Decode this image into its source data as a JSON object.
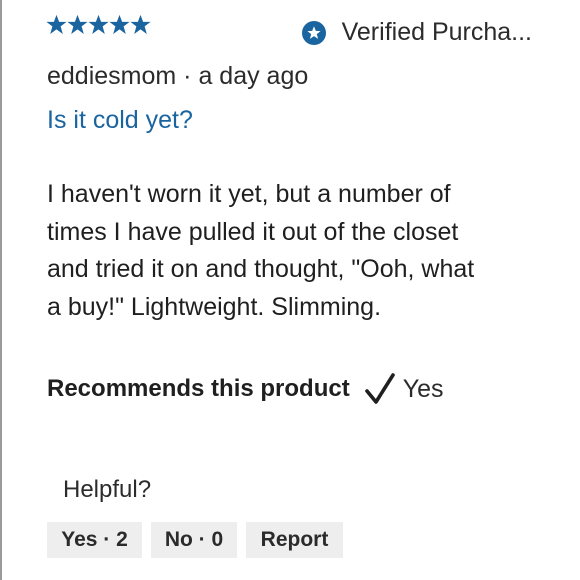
{
  "review": {
    "rating": 5,
    "rating_max": 5,
    "star_icon": "star-icon",
    "star_color": "#1a64a0",
    "verified_label": "Verified Purcha...",
    "verified_icon": "star-in-circle-icon",
    "author": "eddiesmom",
    "separator": " · ",
    "time_ago": "a day ago",
    "title": "Is it cold yet?",
    "title_color": "#1a64a0",
    "body_lines": [
      "I haven't worn it yet, but a number of",
      "times I have pulled it out of the closet",
      "and tried it on and thought, \"Ooh, what",
      "a buy!\" Lightweight. Slimming."
    ],
    "recommends_label": "Recommends this product",
    "recommends_icon": "checkmark-icon",
    "recommends_value": "Yes"
  },
  "feedback": {
    "helpful_label": "Helpful?",
    "yes_label": "Yes · 2",
    "no_label": "No · 0",
    "report_label": "Report",
    "button_bg": "#eeeeee"
  }
}
